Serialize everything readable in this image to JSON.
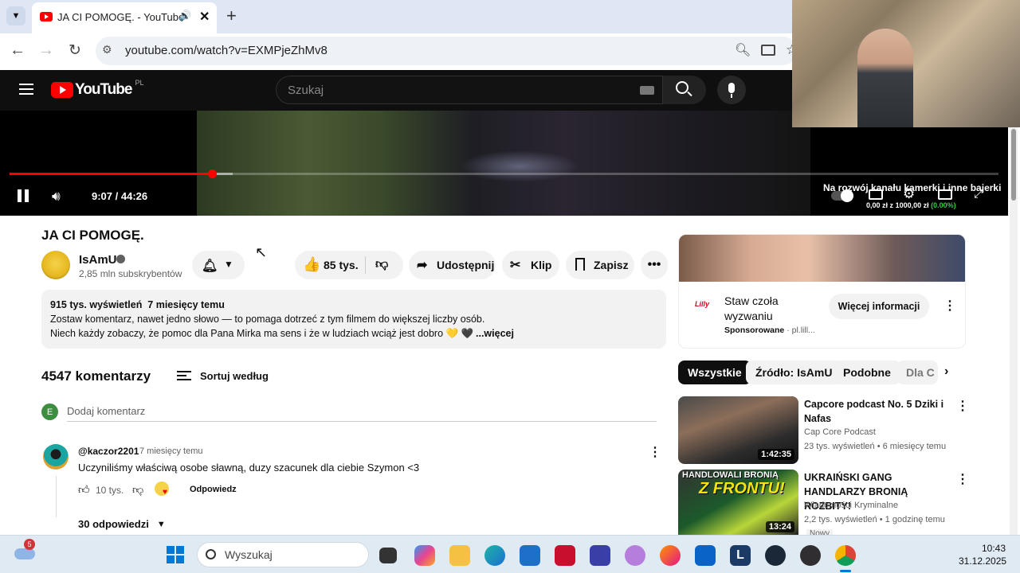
{
  "browser": {
    "tab_title": "JA CI POMOGĘ. - YouTube",
    "url": "youtube.com/watch?v=EXMPjeZhMv8"
  },
  "youtube": {
    "logo": "YouTube",
    "region": "PL",
    "search_placeholder": "Szukaj"
  },
  "player": {
    "time": "9:07 / 44:26",
    "progress": 0.205,
    "overlay_text": "Na rozwój kanału kamerki i inne bajerki",
    "donation": "0,00 zł",
    "donation_of": "z",
    "donation_goal": "1000,00 zł",
    "donation_pct": "(0.00%)"
  },
  "video": {
    "title": "JA CI POMOGĘ.",
    "channel": "IsAmU",
    "subscribers": "2,85 mln subskrybentów",
    "likes": "85 tys.",
    "share": "Udostępnij",
    "clip": "Klip",
    "save": "Zapisz",
    "views_date": "915 tys. wyświetleń  7 miesięcy temu",
    "desc_line1": "Zostaw komentarz, nawet jedno słowo — to pomaga dotrzeć z tym filmem do większej liczby osób.",
    "desc_line2": "Niech każdy zobaczy, że pomoc dla Pana Mirka ma sens i że w ludziach wciąż jest dobro 💛 🖤",
    "desc_more": "...więcej"
  },
  "comments": {
    "count": "4547 komentarzy",
    "sort": "Sortuj według",
    "add_placeholder": "Dodaj komentarz",
    "user_initial": "E",
    "items": [
      {
        "author": "@kaczor2201",
        "time": "7 miesięcy temu",
        "text": "Uczyniliśmy właściwą osobe sławną, duzy szacunek dla ciebie Szymon <3",
        "likes": "10 tys.",
        "reply": "Odpowiedz",
        "replies": "30 odpowiedzi"
      }
    ]
  },
  "ad": {
    "brand": "Lilly",
    "title": "Staw czoła wyzwaniu",
    "sponsored": "Sponsorowane",
    "domain": "· pl.lill...",
    "cta": "Więcej informacji"
  },
  "chips": [
    "Wszystkie",
    "Źródło: IsAmU",
    "Podobne",
    "Dla C"
  ],
  "recommended": [
    {
      "title": "Capcore podcast No. 5 Dziki i Nafas",
      "channel": "Cap Core Podcast",
      "meta": "23 tys. wyświetleń • 6 miesięcy temu",
      "duration": "1:42:35"
    },
    {
      "title": "UKRAIŃSKI GANG HANDLARZY BRONIĄ ROZBITY!",
      "channel": "Wiadomości Kryminalne",
      "meta": "2,2 tys. wyświetleń • 1 godzinę temu",
      "duration": "13:24",
      "thumb_text1": "HANDLOWALI BRONIĄ",
      "thumb_text2": "Z FRONTU!",
      "badge": "Nowy"
    }
  ],
  "taskbar": {
    "weather_badge": "5",
    "search": "Wyszukaj",
    "time": "10:43",
    "date": "31.12.2025"
  },
  "colors": {
    "accent_red": "#ff0000",
    "yt_dark": "#0f0f0f",
    "donation_green": "#2ecc40"
  }
}
